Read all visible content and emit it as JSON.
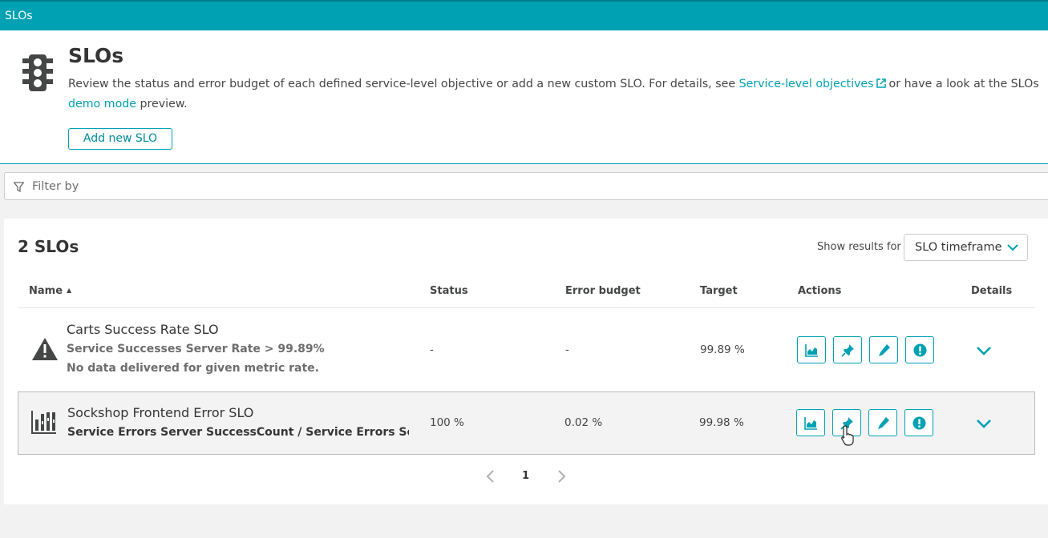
{
  "topbar": {
    "title": "SLOs"
  },
  "header": {
    "icon": "traffic-light-icon",
    "title": "SLOs",
    "description_pre": "Review the status and error budget of each defined service-level objective or add a new custom SLO. For details, see ",
    "link_docs": "Service-level objectives",
    "description_mid": "or have a look at the SLOs ",
    "link_demo": "demo mode",
    "description_post": " preview.",
    "add_button": "Add new SLO"
  },
  "filter": {
    "placeholder": "Filter by",
    "icon": "filter-icon"
  },
  "panel": {
    "count": "2 SLOs",
    "show_results_label": "Show results for",
    "timeframe_select": "SLO timeframe",
    "columns": {
      "name": "Name",
      "status": "Status",
      "error_budget": "Error budget",
      "target": "Target",
      "actions": "Actions",
      "details": "Details"
    },
    "rows": [
      {
        "icon": "warning-icon",
        "name": "Carts Success Rate SLO",
        "metric": "Service Successes Server Rate > 99.89%",
        "note": "No data delivered for given metric rate.",
        "status": "-",
        "error_budget": "-",
        "target": "99.89 %"
      },
      {
        "icon": "bar-chart-icon",
        "name": "Sockshop Frontend Error SLO",
        "metric": "Service Errors Server SuccessCount / Service Errors Server S",
        "status": "100 %",
        "error_budget": "0.02 %",
        "target": "99.98 %"
      }
    ],
    "action_icons": [
      "chart-icon",
      "pin-icon",
      "edit-icon",
      "alert-icon"
    ],
    "pagination": {
      "current": "1"
    }
  },
  "colors": {
    "accent": "#00a1b2",
    "background": "#f2f2f2"
  }
}
